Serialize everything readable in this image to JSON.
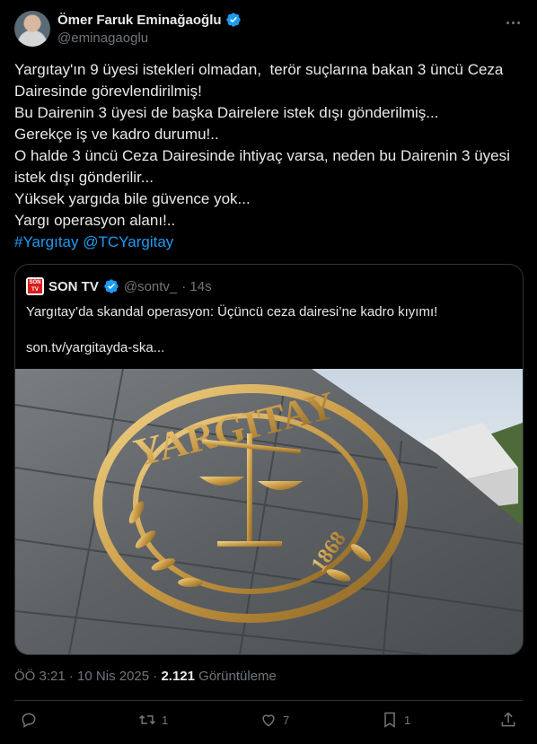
{
  "author": {
    "display_name": "Ömer Faruk Eminağaoğlu",
    "handle": "@eminagaoglu",
    "verified_icon": "verified-badge-icon"
  },
  "tweet": {
    "lines": [
      "Yargıtay'ın 9 üyesi istekleri olmadan,  terör suçlarına bakan 3 üncü Ceza",
      "Dairesinde görevlendirilmiş!",
      "Bu Dairenin 3 üyesi de başka Dairelere istek dışı gönderilmiş...",
      "Gerekçe iş ve kadro durumu!..",
      "O halde 3 üncü Ceza Dairesinde ihtiyaç varsa, neden bu Dairenin 3 üyesi",
      "istek dışı gönderilir...",
      "Yüksek yargıda bile güvence yok...",
      "Yargı operasyon alanı!.."
    ],
    "hashtag": "#Yargıtay",
    "mention": "@TCYargitay"
  },
  "quote": {
    "logo_text": "SON TV",
    "name": "SON TV",
    "handle": "@sontv_",
    "time": "· 14s",
    "text": "Yargıtay’da skandal operasyon: Üçüncü ceza dairesi’ne kadro kıyımı!",
    "url": "son.tv/yargitayda-ska...",
    "image": {
      "seal_top_text": "YARGITAY",
      "seal_year": "1868"
    }
  },
  "meta": {
    "time": "ÖÖ 3:21",
    "sep": "·",
    "date": "10 Nis 2025",
    "views_count": "2.121",
    "views_label": "Görüntüleme"
  },
  "actions": {
    "reply": "",
    "retweet": "1",
    "like": "7",
    "bookmark": "1"
  },
  "colors": {
    "background": "#000000",
    "text": "#e7e9ea",
    "secondary": "#71767b",
    "link": "#1d9bf0",
    "border": "#2f3336"
  }
}
